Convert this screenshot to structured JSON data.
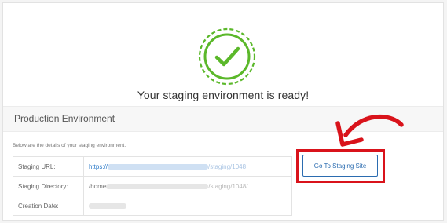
{
  "status": {
    "message": "Your staging environment is ready!",
    "icon": "check-circle-icon",
    "color": "#5bb82a"
  },
  "section": {
    "title": "Production Environment",
    "intro": "Below are the details of your staging environment."
  },
  "details": [
    {
      "label": "Staging URL:",
      "value_prefix": "https://",
      "value_suffix": "/staging/1048"
    },
    {
      "label": "Staging Directory:",
      "value_prefix": "/home",
      "value_suffix": "/staging/1048/"
    },
    {
      "label": "Creation Date:",
      "value_prefix": "",
      "value_suffix": ""
    }
  ],
  "button": {
    "label": "Go To Staging Site"
  },
  "annotation": {
    "arrow_icon": "curved-arrow-icon",
    "color": "#d9131b"
  }
}
